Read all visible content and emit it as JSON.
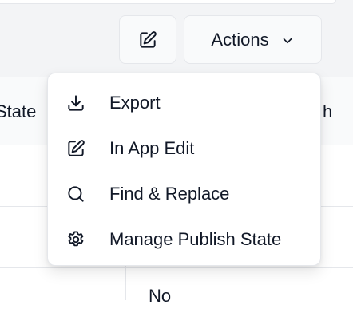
{
  "toolbar": {
    "edit_icon": "pencil-square-icon",
    "actions_label": "Actions",
    "actions_icon": "chevron-down-icon"
  },
  "table": {
    "header_left": "State",
    "header_right": "h",
    "cell_bottom": "No"
  },
  "menu": {
    "items": [
      {
        "label": "Export",
        "icon": "download-icon"
      },
      {
        "label": "In App Edit",
        "icon": "pencil-square-icon"
      },
      {
        "label": "Find & Replace",
        "icon": "search-icon"
      },
      {
        "label": "Manage Publish State",
        "icon": "gear-icon"
      }
    ]
  }
}
